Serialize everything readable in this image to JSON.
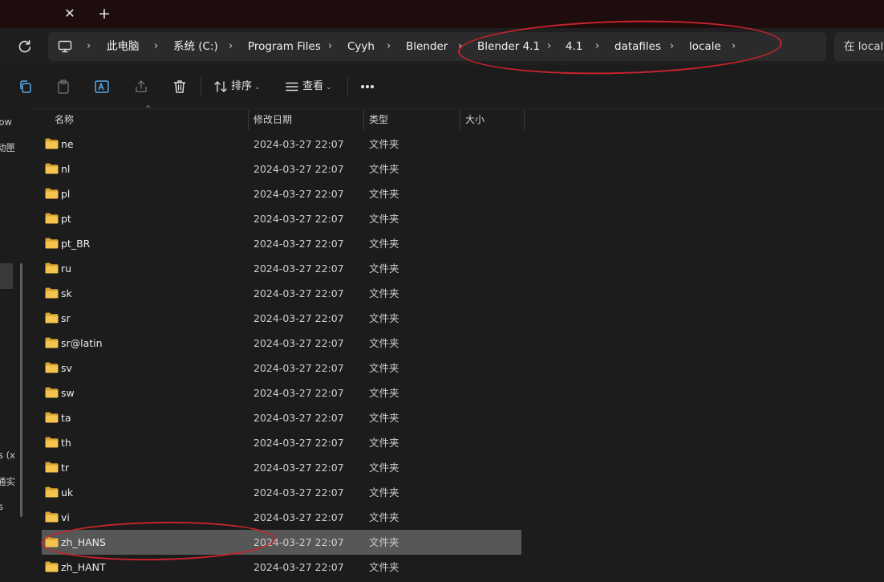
{
  "tabbar": {
    "close_glyph": "✕",
    "new_tab_glyph": "+"
  },
  "address": {
    "crumbs": [
      "此电脑",
      "系统 (C:)",
      "Program Files",
      "Cyyh",
      "Blender",
      "Blender 4.1",
      "4.1",
      "datafiles",
      "locale"
    ],
    "chevron": "›",
    "search_placeholder": "在 locale 中搜索"
  },
  "toolbar": {
    "sort_label": "排序",
    "view_label": "查看",
    "caret": "⌄"
  },
  "sidebar": {
    "fragments": [
      "row",
      "动匣",
      "s (x",
      "通实",
      "s"
    ]
  },
  "columns": {
    "name": "名称",
    "modified": "修改日期",
    "type": "类型",
    "size": "大小",
    "sort_arrow": "^"
  },
  "files": [
    {
      "name": "ne",
      "modified": "2024-03-27 22:07",
      "type": "文件夹"
    },
    {
      "name": "nl",
      "modified": "2024-03-27 22:07",
      "type": "文件夹"
    },
    {
      "name": "pl",
      "modified": "2024-03-27 22:07",
      "type": "文件夹"
    },
    {
      "name": "pt",
      "modified": "2024-03-27 22:07",
      "type": "文件夹"
    },
    {
      "name": "pt_BR",
      "modified": "2024-03-27 22:07",
      "type": "文件夹"
    },
    {
      "name": "ru",
      "modified": "2024-03-27 22:07",
      "type": "文件夹"
    },
    {
      "name": "sk",
      "modified": "2024-03-27 22:07",
      "type": "文件夹"
    },
    {
      "name": "sr",
      "modified": "2024-03-27 22:07",
      "type": "文件夹"
    },
    {
      "name": "sr@latin",
      "modified": "2024-03-27 22:07",
      "type": "文件夹"
    },
    {
      "name": "sv",
      "modified": "2024-03-27 22:07",
      "type": "文件夹"
    },
    {
      "name": "sw",
      "modified": "2024-03-27 22:07",
      "type": "文件夹"
    },
    {
      "name": "ta",
      "modified": "2024-03-27 22:07",
      "type": "文件夹"
    },
    {
      "name": "th",
      "modified": "2024-03-27 22:07",
      "type": "文件夹"
    },
    {
      "name": "tr",
      "modified": "2024-03-27 22:07",
      "type": "文件夹"
    },
    {
      "name": "uk",
      "modified": "2024-03-27 22:07",
      "type": "文件夹"
    },
    {
      "name": "vi",
      "modified": "2024-03-27 22:07",
      "type": "文件夹"
    },
    {
      "name": "zh_HANS",
      "modified": "2024-03-27 22:07",
      "type": "文件夹",
      "selected": true
    },
    {
      "name": "zh_HANT",
      "modified": "2024-03-27 22:07",
      "type": "文件夹"
    }
  ],
  "colors": {
    "folder": "#f4c44e",
    "folder_dark": "#d9a532",
    "annotation": "#c8232c",
    "selection": "#575757"
  }
}
